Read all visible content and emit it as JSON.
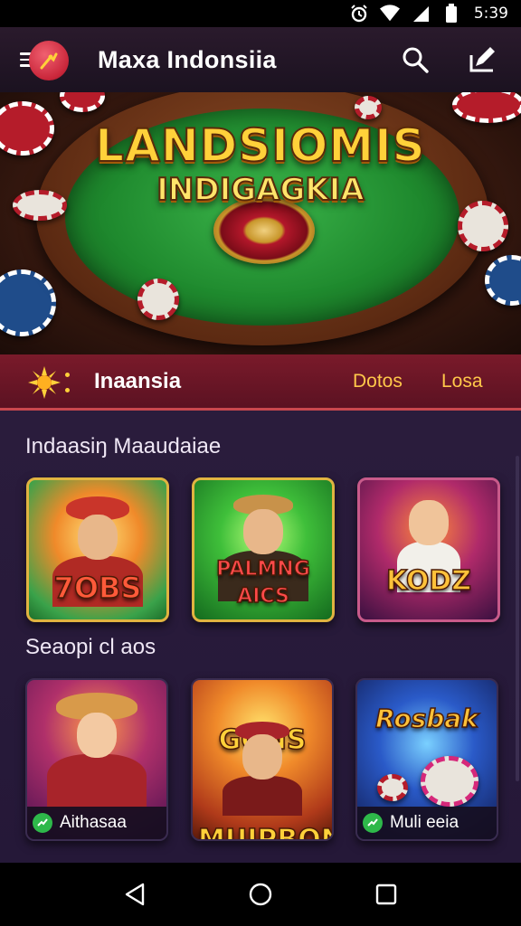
{
  "status_bar": {
    "time": "5:39",
    "icons": [
      "alarm-icon",
      "wifi-icon",
      "signal-icon",
      "battery-icon"
    ]
  },
  "app_bar": {
    "title": "Maxa  Indonsiia",
    "icons": [
      "menu-icon",
      "app-logo",
      "search-icon",
      "edit-icon"
    ]
  },
  "hero": {
    "title_line1": "LANDSIOMIS",
    "title_line2": "INDIGAGKIA"
  },
  "tabs": {
    "active_label": "Inaansia",
    "items": [
      "Dotos",
      "Losa"
    ]
  },
  "sections": [
    {
      "title": "Indaasiŋ  Maaudaiae",
      "games": [
        {
          "art_text": "7OBS",
          "name": ""
        },
        {
          "art_text": "PALMNG AICS",
          "name": ""
        },
        {
          "art_text": "KODZ",
          "name": ""
        }
      ]
    },
    {
      "title": "Seaopi cl aos",
      "games": [
        {
          "art_text": "",
          "name": "Aithasaa"
        },
        {
          "art_text": "GONS MUIPBONS",
          "name": ""
        },
        {
          "art_text": "Rosbak",
          "name": "Muli eeia"
        }
      ]
    }
  ],
  "nav_bar": {
    "icons": [
      "back-icon",
      "home-icon",
      "recents-icon"
    ]
  },
  "colors": {
    "accent_gold": "#ffd13a",
    "tab_bar": "#6b1626",
    "content_bg": "#2a1c3c",
    "badge_green": "#2eb84a"
  }
}
